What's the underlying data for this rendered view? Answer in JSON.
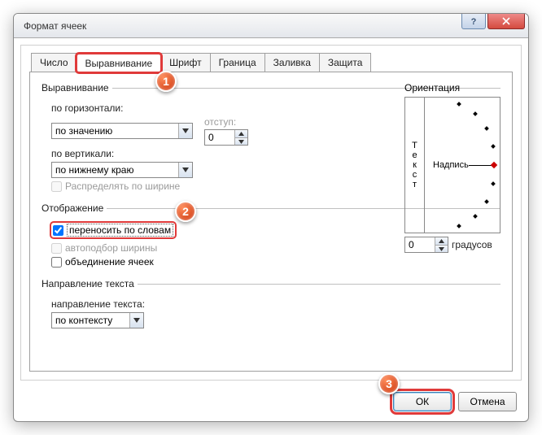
{
  "window": {
    "title": "Формат ячеек"
  },
  "tabs": {
    "number": "Число",
    "alignment": "Выравнивание",
    "font": "Шрифт",
    "border": "Граница",
    "fill": "Заливка",
    "protection": "Защита",
    "active": "alignment"
  },
  "alignmentGroup": {
    "legend": "Выравнивание",
    "horizontalLabel": "по горизонтали:",
    "horizontalValue": "по значению",
    "indentLabel": "отступ:",
    "indentValue": "0",
    "verticalLabel": "по вертикали:",
    "verticalValue": "по нижнему краю",
    "distributeLabel": "Распределять по ширине",
    "distributeEnabled": false
  },
  "displayGroup": {
    "legend": "Отображение",
    "wrapLabel": "переносить по словам",
    "wrapChecked": true,
    "shrinkLabel": "автоподбор ширины",
    "shrinkEnabled": false,
    "mergeLabel": "объединение ячеек",
    "mergeChecked": false
  },
  "textDirGroup": {
    "legend": "Направление текста",
    "label": "направление текста:",
    "value": "по контексту"
  },
  "orientation": {
    "legend": "Ориентация",
    "vertText": "Текст",
    "label": "Надпись",
    "degrees": "0",
    "degreesLabel": "градусов"
  },
  "buttons": {
    "ok": "ОК",
    "cancel": "Отмена"
  },
  "callouts": {
    "1": "1",
    "2": "2",
    "3": "3"
  }
}
